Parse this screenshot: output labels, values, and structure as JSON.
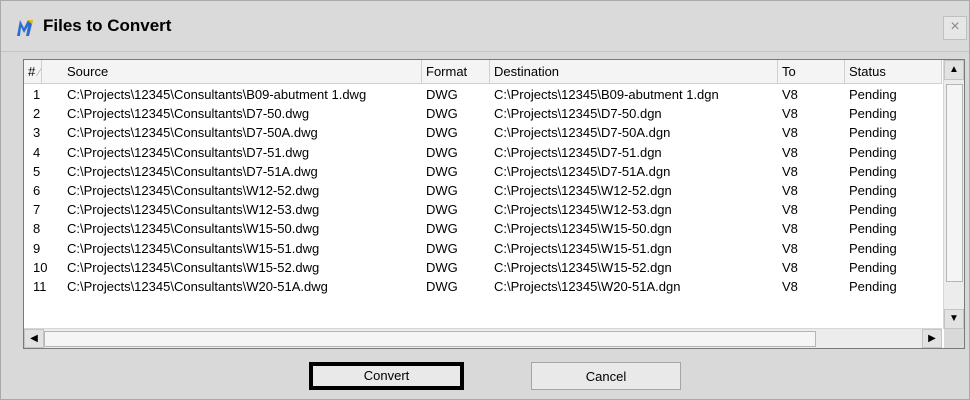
{
  "window": {
    "title": "Files to Convert",
    "close_glyph": "×"
  },
  "icons": {
    "app": "app-logo-icon",
    "close": "close-icon",
    "sort": "sort-indicator-icon"
  },
  "columns": {
    "num": "#",
    "source": "Source",
    "format": "Format",
    "destination": "Destination",
    "to": "To",
    "status": "Status"
  },
  "rows": [
    {
      "num": "1",
      "source": "C:\\Projects\\12345\\Consultants\\B09-abutment 1.dwg",
      "format": "DWG",
      "destination": "C:\\Projects\\12345\\B09-abutment 1.dgn",
      "to": "V8",
      "status": "Pending"
    },
    {
      "num": "2",
      "source": "C:\\Projects\\12345\\Consultants\\D7-50.dwg",
      "format": "DWG",
      "destination": "C:\\Projects\\12345\\D7-50.dgn",
      "to": "V8",
      "status": "Pending"
    },
    {
      "num": "3",
      "source": "C:\\Projects\\12345\\Consultants\\D7-50A.dwg",
      "format": "DWG",
      "destination": "C:\\Projects\\12345\\D7-50A.dgn",
      "to": "V8",
      "status": "Pending"
    },
    {
      "num": "4",
      "source": "C:\\Projects\\12345\\Consultants\\D7-51.dwg",
      "format": "DWG",
      "destination": "C:\\Projects\\12345\\D7-51.dgn",
      "to": "V8",
      "status": "Pending"
    },
    {
      "num": "5",
      "source": "C:\\Projects\\12345\\Consultants\\D7-51A.dwg",
      "format": "DWG",
      "destination": "C:\\Projects\\12345\\D7-51A.dgn",
      "to": "V8",
      "status": "Pending"
    },
    {
      "num": "6",
      "source": "C:\\Projects\\12345\\Consultants\\W12-52.dwg",
      "format": "DWG",
      "destination": "C:\\Projects\\12345\\W12-52.dgn",
      "to": "V8",
      "status": "Pending"
    },
    {
      "num": "7",
      "source": "C:\\Projects\\12345\\Consultants\\W12-53.dwg",
      "format": "DWG",
      "destination": "C:\\Projects\\12345\\W12-53.dgn",
      "to": "V8",
      "status": "Pending"
    },
    {
      "num": "8",
      "source": "C:\\Projects\\12345\\Consultants\\W15-50.dwg",
      "format": "DWG",
      "destination": "C:\\Projects\\12345\\W15-50.dgn",
      "to": "V8",
      "status": "Pending"
    },
    {
      "num": "9",
      "source": "C:\\Projects\\12345\\Consultants\\W15-51.dwg",
      "format": "DWG",
      "destination": "C:\\Projects\\12345\\W15-51.dgn",
      "to": "V8",
      "status": "Pending"
    },
    {
      "num": "10",
      "source": "C:\\Projects\\12345\\Consultants\\W15-52.dwg",
      "format": "DWG",
      "destination": "C:\\Projects\\12345\\W15-52.dgn",
      "to": "V8",
      "status": "Pending"
    },
    {
      "num": "11",
      "source": "C:\\Projects\\12345\\Consultants\\W20-51A.dwg",
      "format": "DWG",
      "destination": "C:\\Projects\\12345\\W20-51A.dgn",
      "to": "V8",
      "status": "Pending"
    }
  ],
  "buttons": {
    "convert": "Convert",
    "cancel": "Cancel"
  },
  "scroll_arrows": {
    "up": "▲",
    "down": "▼",
    "left": "◀",
    "right": "▶"
  }
}
